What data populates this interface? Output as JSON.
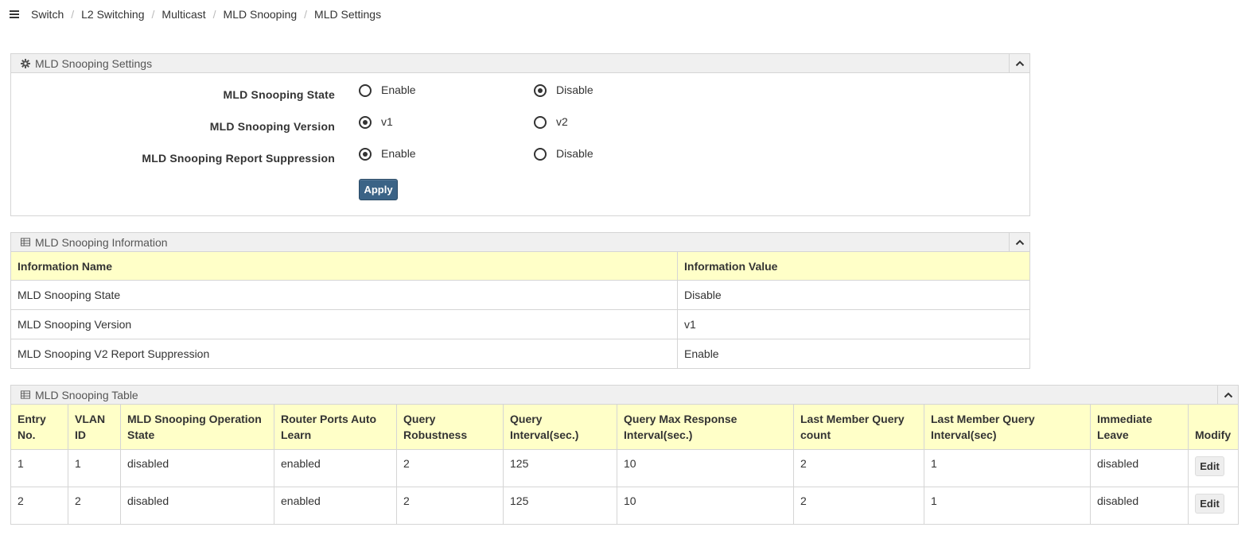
{
  "breadcrumb": [
    "Switch",
    "L2 Switching",
    "Multicast",
    "MLD Snooping",
    "MLD Settings"
  ],
  "settings_panel": {
    "title": "MLD Snooping Settings",
    "rows": [
      {
        "label": "MLD Snooping State",
        "options": [
          "Enable",
          "Disable"
        ],
        "selected": "Disable"
      },
      {
        "label": "MLD Snooping Version",
        "options": [
          "v1",
          "v2"
        ],
        "selected": "v1"
      },
      {
        "label": "MLD Snooping Report Suppression",
        "options": [
          "Enable",
          "Disable"
        ],
        "selected": "Enable"
      }
    ],
    "apply_label": "Apply"
  },
  "info_panel": {
    "title": "MLD Snooping Information",
    "headers": [
      "Information Name",
      "Information Value"
    ],
    "rows": [
      [
        "MLD Snooping State",
        "Disable"
      ],
      [
        "MLD Snooping Version",
        "v1"
      ],
      [
        "MLD Snooping V2 Report Suppression",
        "Enable"
      ]
    ]
  },
  "table_panel": {
    "title": "MLD Snooping Table",
    "headers": [
      "Entry No.",
      "VLAN ID",
      "MLD Snooping Operation State",
      "Router Ports Auto Learn",
      "Query Robustness",
      "Query Interval(sec.)",
      "Query Max Response Interval(sec.)",
      "Last Member Query count",
      "Last Member Query Interval(sec)",
      "Immediate Leave",
      "Modify"
    ],
    "rows": [
      [
        "1",
        "1",
        "disabled",
        "enabled",
        "2",
        "125",
        "10",
        "2",
        "1",
        "disabled"
      ],
      [
        "2",
        "2",
        "disabled",
        "enabled",
        "2",
        "125",
        "10",
        "2",
        "1",
        "disabled"
      ]
    ],
    "edit_label": "Edit"
  },
  "colors": {
    "header_bg": "#ffffc8",
    "panel_header_bg": "#f0f0f0",
    "apply_button": "#3b6386"
  },
  "icons": {
    "menu": "hamburger-icon",
    "settings": "gear-icon",
    "table": "table-icon",
    "collapse": "chevron-up-icon"
  }
}
